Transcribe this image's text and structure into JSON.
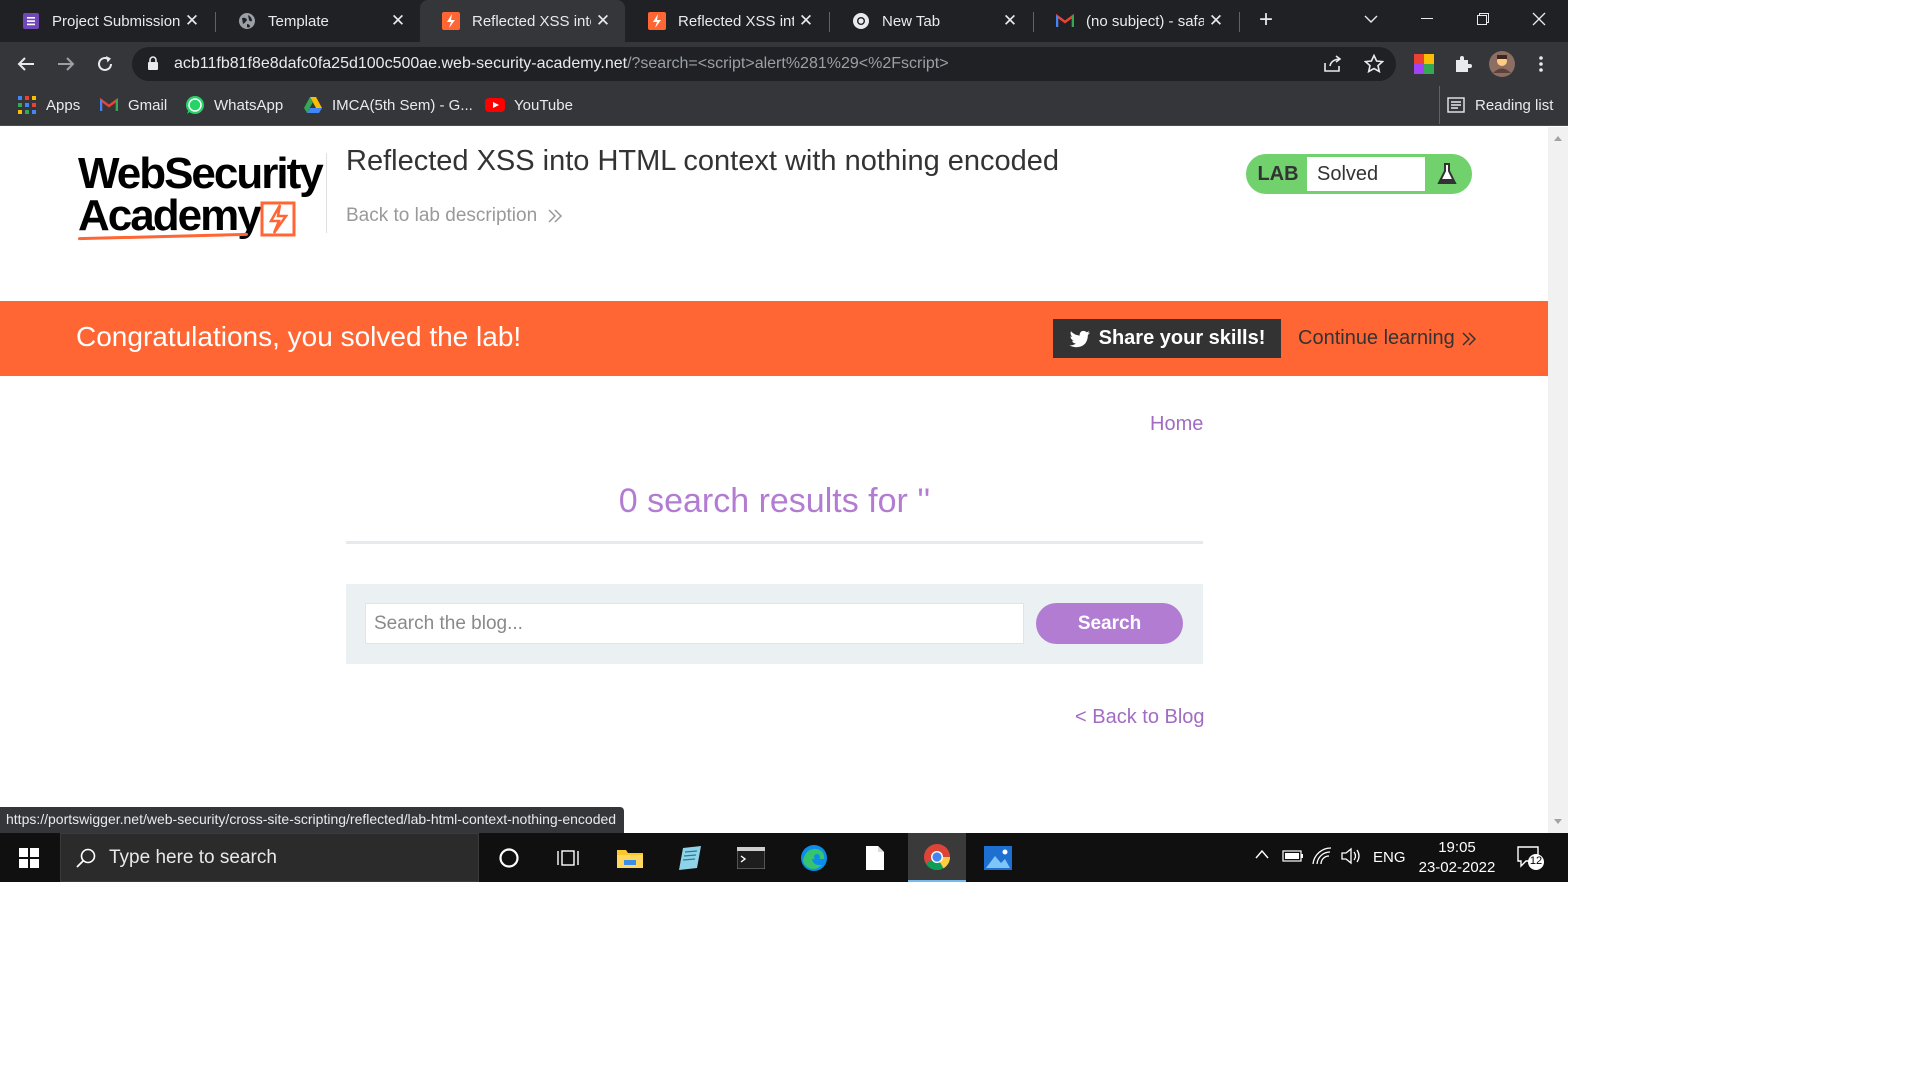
{
  "browser": {
    "tabs": [
      {
        "title": "Project Submission",
        "icon": "forms-icon",
        "active": false
      },
      {
        "title": "Template",
        "icon": "globe-icon",
        "active": false
      },
      {
        "title": "Reflected XSS into HTML",
        "icon": "portswigger-icon",
        "active": true
      },
      {
        "title": "Reflected XSS into HTML",
        "icon": "portswigger-icon",
        "active": false
      },
      {
        "title": "New Tab",
        "icon": "chrome-icon",
        "active": false
      },
      {
        "title": "(no subject) - safaly",
        "icon": "gmail-icon",
        "active": false
      }
    ],
    "url_host": "acb11fb81f8e8dafc0fa25d100c500ae.web-security-academy.net",
    "url_rest": "/?search=<script>alert%281%29<%2Fscript>",
    "bookmarks": [
      {
        "label": "Apps",
        "icon": "apps-grid-icon"
      },
      {
        "label": "Gmail",
        "icon": "gmail-icon"
      },
      {
        "label": "WhatsApp",
        "icon": "whatsapp-icon"
      },
      {
        "label": "IMCA(5th Sem) - G...",
        "icon": "google-drive-icon"
      },
      {
        "label": "YouTube",
        "icon": "youtube-icon"
      }
    ],
    "reading_list": "Reading list",
    "status_url": "https://portswigger.net/web-security/cross-site-scripting/reflected/lab-html-context-nothing-encoded"
  },
  "page": {
    "logo_line1": "WebSecurity",
    "logo_line2": "Academy",
    "lab_title": "Reflected XSS into HTML context with nothing encoded",
    "back_to_description": "Back to lab description",
    "lab_badge": {
      "label": "LAB",
      "status": "Solved"
    },
    "congrats": "Congratulations, you solved the lab!",
    "share_button": "Share your skills!",
    "continue_learning": "Continue learning",
    "home_link": "Home",
    "results_heading": "0 search results for ''",
    "search_placeholder": "Search the blog...",
    "search_button": "Search",
    "back_to_blog": "< Back to Blog"
  },
  "taskbar": {
    "search_placeholder": "Type here to search",
    "language": "ENG",
    "time": "19:05",
    "date": "23-02-2022",
    "notification_count": "12"
  },
  "colors": {
    "accent_orange": "#ff6633",
    "link_purple": "#a26cc2",
    "button_purple": "#b27cd3",
    "solved_green": "#70d16d"
  }
}
